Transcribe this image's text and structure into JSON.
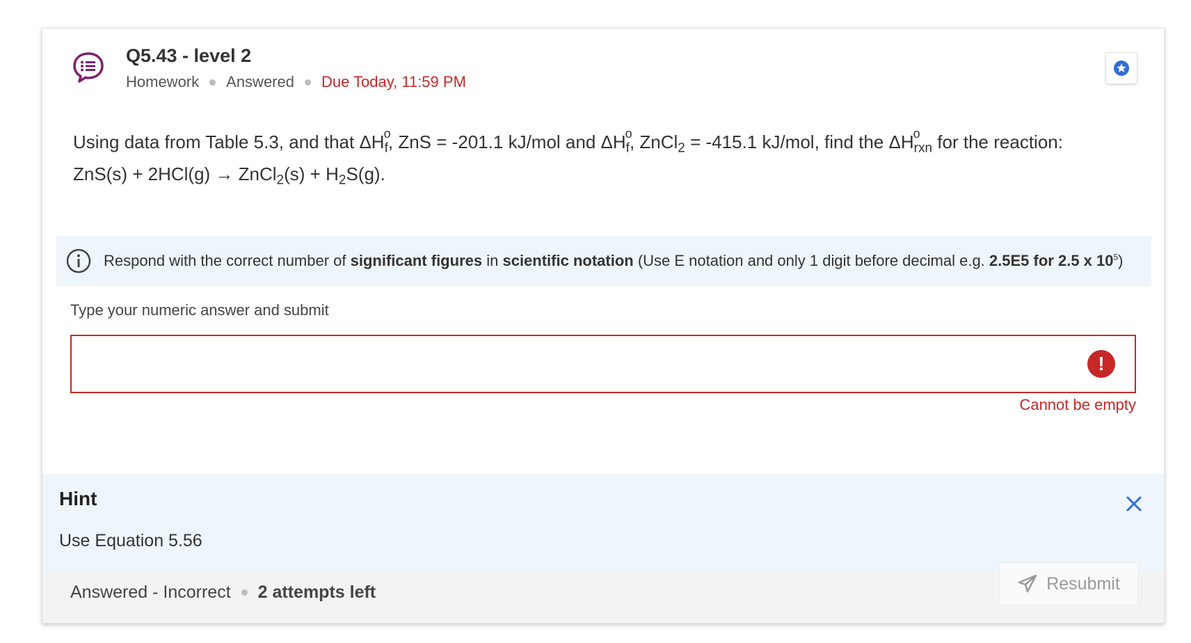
{
  "question": {
    "title": "Q5.43 - level 2",
    "type": "Homework",
    "status": "Answered",
    "due": "Due Today, 11:59 PM",
    "text_parts": {
      "intro": "Using data from Table 5.3, and that ΔH",
      "f_sub": "f",
      "zns_value": ", ZnS = -201.1 kJ/mol and ΔH",
      "zncl2_lead": ", ZnCl",
      "sub_2": "2",
      "zncl2_value": " = -415.1 kJ/mol, find the ΔH",
      "rxn_sub": "rxn",
      "tail": " for the reaction:",
      "eq_a": "ZnS(s) + 2HCl(g) → ZnCl",
      "eq_b": "(s) + H",
      "eq_c": "S(g).",
      "degree": "o"
    }
  },
  "instruction": {
    "prefix": "Respond with the correct number of ",
    "bold1": "significant figures",
    "mid": " in ",
    "bold2": "scientific notation",
    "suffix": " (Use E notation and only 1 digit before decimal e.g. ",
    "bold3": "2.5E5 for 2.5 x 10",
    "exp": "5",
    "close": ")"
  },
  "answer": {
    "label": "Type your numeric answer and submit",
    "value": "",
    "placeholder": "",
    "error": "Cannot be empty",
    "error_icon": "!"
  },
  "hint": {
    "title": "Hint",
    "text": "Use Equation 5.56"
  },
  "footer": {
    "status": "Answered - Incorrect",
    "attempts": "2 attempts left",
    "resubmit_label": "Resubmit"
  },
  "colors": {
    "accent_purple": "#7b1f6e",
    "error_red": "#c62828",
    "info_bg": "#eef5fb",
    "link_blue": "#2f6fd6"
  },
  "icons": {
    "question": "chat-list-icon",
    "star": "star-badge-icon",
    "info": "info-icon",
    "error": "error-icon",
    "close": "close-icon",
    "send": "send-icon"
  }
}
